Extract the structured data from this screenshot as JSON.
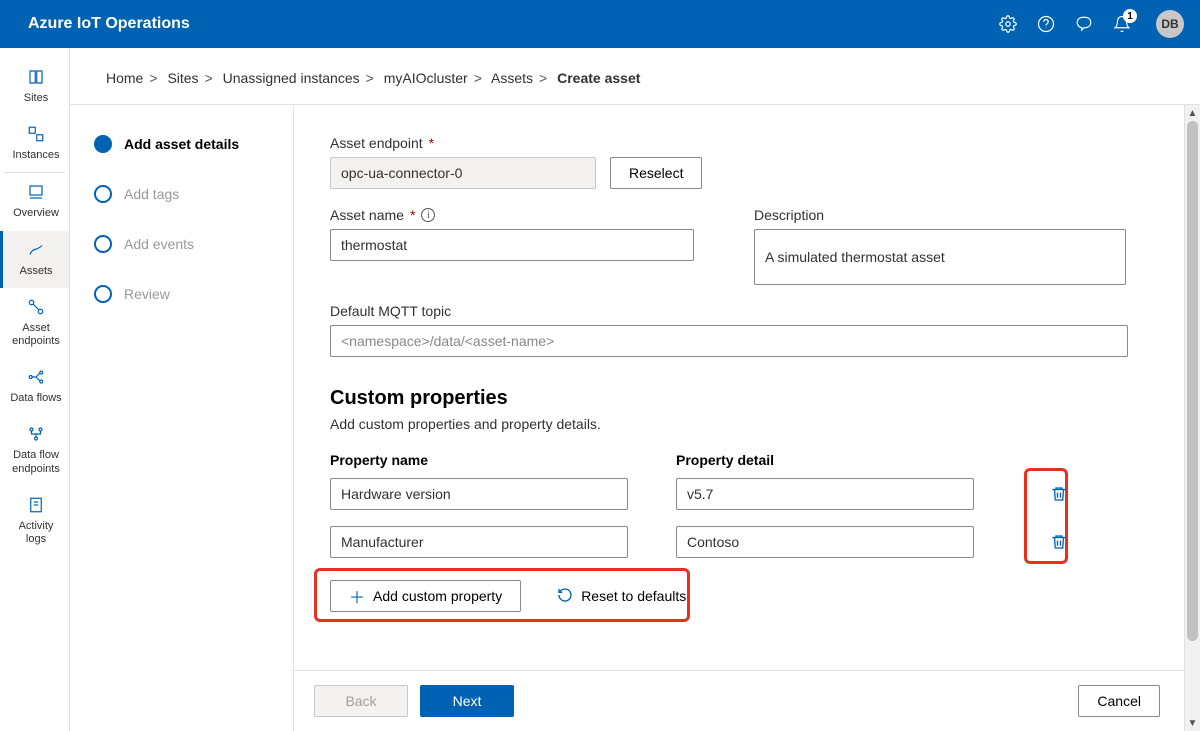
{
  "header": {
    "title": "Azure IoT Operations",
    "notification_count": "1",
    "user_initials": "DB"
  },
  "left_nav": {
    "items": [
      {
        "label": "Sites"
      },
      {
        "label": "Instances"
      },
      {
        "label": "Overview"
      },
      {
        "label": "Assets"
      },
      {
        "label": "Asset endpoints"
      },
      {
        "label": "Data flows"
      },
      {
        "label": "Data flow endpoints"
      },
      {
        "label": "Activity logs"
      }
    ]
  },
  "breadcrumb": {
    "items": [
      "Home",
      "Sites",
      "Unassigned instances",
      "myAIOcluster",
      "Assets"
    ],
    "current": "Create asset"
  },
  "stepper": {
    "steps": [
      {
        "label": "Add asset details"
      },
      {
        "label": "Add tags"
      },
      {
        "label": "Add events"
      },
      {
        "label": "Review"
      }
    ]
  },
  "form": {
    "endpoint_label": "Asset endpoint",
    "endpoint_value": "opc-ua-connector-0",
    "reselect_label": "Reselect",
    "name_label": "Asset name",
    "name_value": "thermostat",
    "description_label": "Description",
    "description_value": "A simulated thermostat asset",
    "mqtt_label": "Default MQTT topic",
    "mqtt_placeholder": "<namespace>/data/<asset-name>",
    "custom_props_title": "Custom properties",
    "custom_props_sub": "Add custom properties and property details.",
    "col_name": "Property name",
    "col_detail": "Property detail",
    "properties": [
      {
        "name": "Hardware version",
        "detail": "v5.7"
      },
      {
        "name": "Manufacturer",
        "detail": "Contoso"
      }
    ],
    "add_prop_label": "Add custom property",
    "reset_label": "Reset to defaults"
  },
  "footer": {
    "back": "Back",
    "next": "Next",
    "cancel": "Cancel"
  }
}
